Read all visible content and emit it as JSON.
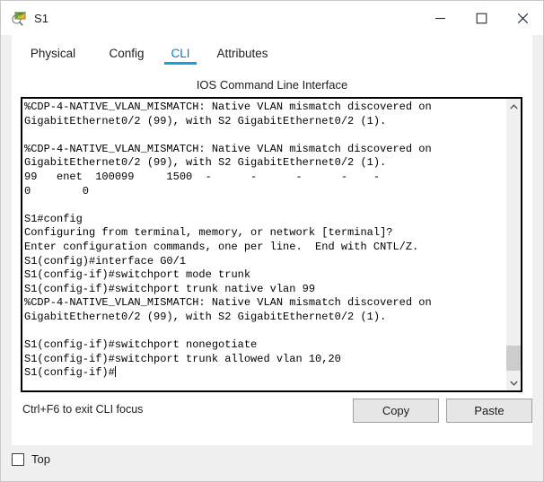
{
  "window": {
    "title": "S1",
    "icon": "switch-magnifier-icon",
    "controls": {
      "minimize": "minimize-icon",
      "maximize": "maximize-icon",
      "close": "close-icon"
    }
  },
  "tabs": [
    {
      "label": "Physical",
      "active": false
    },
    {
      "label": "Config",
      "active": false
    },
    {
      "label": "CLI",
      "active": true
    },
    {
      "label": "Attributes",
      "active": false
    }
  ],
  "section": {
    "title": "IOS Command Line Interface"
  },
  "terminal": {
    "text": "%CDP-4-NATIVE_VLAN_MISMATCH: Native VLAN mismatch discovered on\nGigabitEthernet0/2 (99), with S2 GigabitEthernet0/2 (1).\n\n%CDP-4-NATIVE_VLAN_MISMATCH: Native VLAN mismatch discovered on\nGigabitEthernet0/2 (99), with S2 GigabitEthernet0/2 (1).\n99   enet  100099     1500  -      -      -      -    -\n0        0\n\nS1#config\nConfiguring from terminal, memory, or network [terminal]?\nEnter configuration commands, one per line.  End with CNTL/Z.\nS1(config)#interface G0/1\nS1(config-if)#switchport mode trunk\nS1(config-if)#switchport trunk native vlan 99\n%CDP-4-NATIVE_VLAN_MISMATCH: Native VLAN mismatch discovered on\nGigabitEthernet0/2 (99), with S2 GigabitEthernet0/2 (1).\n\nS1(config-if)#switchport nonegotiate\nS1(config-if)#switchport trunk allowed vlan 10,20\nS1(config-if)#",
    "scrollbar": {
      "up_arrow": "chevron-up-icon",
      "down_arrow": "chevron-down-icon"
    }
  },
  "actions": {
    "hint": "Ctrl+F6 to exit CLI focus",
    "copy_label": "Copy",
    "paste_label": "Paste"
  },
  "footer": {
    "top_checkbox_label": "Top",
    "top_checked": false
  },
  "colors": {
    "accent": "#12a0e0",
    "tab_active_text": "#0a7ac0",
    "window_bg": "#f0f0f0",
    "panel_bg": "#ffffff",
    "terminal_border": "#000000",
    "button_bg": "#e6e6e6"
  }
}
